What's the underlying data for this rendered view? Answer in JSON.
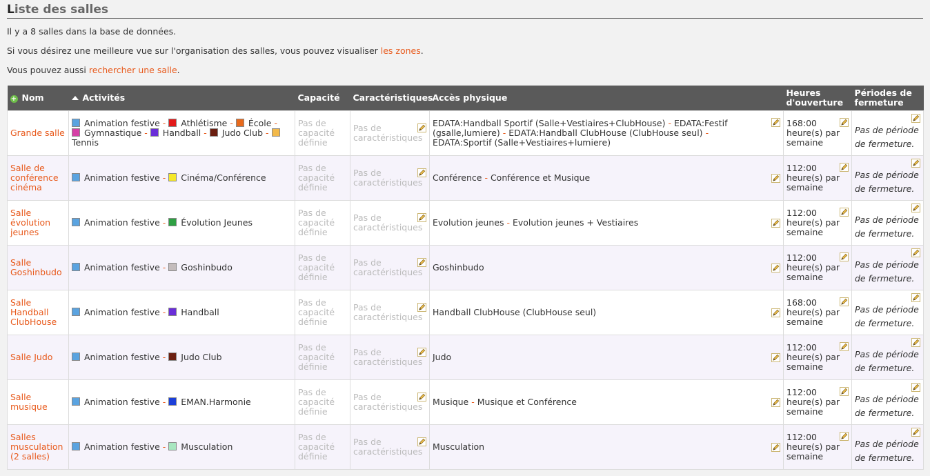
{
  "page": {
    "title_first_letter": "L",
    "title_rest": "iste des salles",
    "intro_count": "Il y a 8 salles dans la base de données.",
    "intro_zones_text": "Si vous désirez une meilleure vue sur l'organisation des salles, vous pouvez visualiser ",
    "intro_zones_link": "les zones",
    "intro_zones_end": ".",
    "intro_search_text": "Vous pouvez aussi ",
    "intro_search_link": "rechercher une salle",
    "intro_search_end": "."
  },
  "table": {
    "headers": {
      "nom": "Nom",
      "activites": "Activités",
      "capacite": "Capacité",
      "caracteristiques": "Caractéristiques",
      "acces": "Accès physique",
      "heures": "Heures d'ouverture",
      "periodes": "Périodes de fermeture"
    },
    "defaults": {
      "capacite": "Pas de capacité définie",
      "caracteristiques": "Pas de caractéristiques",
      "heures_unit": "heure(s) par semaine",
      "periodes": "Pas de période de fermeture."
    },
    "rows": [
      {
        "nom": "Grande salle",
        "activites": [
          {
            "label": "Animation festive",
            "color": "#5aa3e0"
          },
          {
            "label": "Athlétisme",
            "color": "#e21b1b"
          },
          {
            "label": "École",
            "color": "#e86a1c"
          },
          {
            "label": "Gymnastique",
            "color": "#d63fa6"
          },
          {
            "label": "Handball",
            "color": "#6a2ed8"
          },
          {
            "label": "Judo Club",
            "color": "#6b1e10"
          },
          {
            "label": "Tennis",
            "color": "#f2b94a"
          }
        ],
        "acces": [
          "EDATA:Handball Sportif (Salle+Vestiaires+ClubHouse)",
          "EDATA:Festif (gsalle,lumiere)",
          "EDATA:Handball ClubHouse (ClubHouse seul)",
          "EDATA:Sportif (Salle+Vestiaires+lumiere)"
        ],
        "heures": "168:00"
      },
      {
        "nom": "Salle de conférence cinéma",
        "activites": [
          {
            "label": "Animation festive",
            "color": "#5aa3e0"
          },
          {
            "label": "Cinéma/Conférence",
            "color": "#f5e82a"
          }
        ],
        "acces": [
          "Conférence",
          "Conférence et Musique"
        ],
        "heures": "112:00"
      },
      {
        "nom": "Salle évolution jeunes",
        "activites": [
          {
            "label": "Animation festive",
            "color": "#5aa3e0"
          },
          {
            "label": "Évolution Jeunes",
            "color": "#2ea043"
          }
        ],
        "acces": [
          "Evolution jeunes",
          "Evolution jeunes + Vestiaires"
        ],
        "heures": "112:00"
      },
      {
        "nom": "Salle Goshinbudo",
        "activites": [
          {
            "label": "Animation festive",
            "color": "#5aa3e0"
          },
          {
            "label": "Goshinbudo",
            "color": "#c4bcbc"
          }
        ],
        "acces": [
          "Goshinbudo"
        ],
        "heures": "112:00"
      },
      {
        "nom": "Salle Handball ClubHouse",
        "activites": [
          {
            "label": "Animation festive",
            "color": "#5aa3e0"
          },
          {
            "label": "Handball",
            "color": "#6a2ed8"
          }
        ],
        "acces": [
          "Handball ClubHouse (ClubHouse seul)"
        ],
        "heures": "168:00"
      },
      {
        "nom": "Salle Judo",
        "activites": [
          {
            "label": "Animation festive",
            "color": "#5aa3e0"
          },
          {
            "label": "Judo Club",
            "color": "#6b1e10"
          }
        ],
        "acces": [
          "Judo"
        ],
        "heures": "112:00"
      },
      {
        "nom": "Salle musique",
        "activites": [
          {
            "label": "Animation festive",
            "color": "#5aa3e0"
          },
          {
            "label": "EMAN.Harmonie",
            "color": "#1c3fd8"
          }
        ],
        "acces": [
          "Musique",
          "Musique et Conférence"
        ],
        "heures": "112:00"
      },
      {
        "nom": "Salles musculation (2 salles)",
        "activites": [
          {
            "label": "Animation festive",
            "color": "#5aa3e0"
          },
          {
            "label": "Musculation",
            "color": "#a8e6c0"
          }
        ],
        "acces": [
          "Musculation"
        ],
        "heures": "112:00"
      }
    ]
  }
}
